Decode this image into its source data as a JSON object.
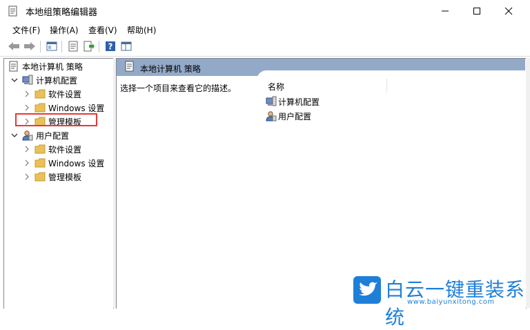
{
  "window": {
    "title": "本地组策略编辑器"
  },
  "menu": [
    "文件(F)",
    "操作(A)",
    "查看(V)",
    "帮助(H)"
  ],
  "tree": {
    "root": "本地计算机 策略",
    "computer_config": "计算机配置",
    "computer_children": [
      "软件设置",
      "Windows 设置",
      "管理模板"
    ],
    "user_config": "用户配置",
    "user_children": [
      "软件设置",
      "Windows 设置",
      "管理模板"
    ]
  },
  "right": {
    "header": "本地计算机 策略",
    "description": "选择一个项目来查看它的描述。",
    "column_name": "名称",
    "items": [
      "计算机配置",
      "用户配置"
    ]
  },
  "watermark": {
    "brand": "白云一键重装系统",
    "url": "www.baiyunxitong.com"
  },
  "colors": {
    "header_band": "#93a9c8",
    "highlight": "#e53935",
    "folder": "#e8c15a",
    "watermark": "#1e7fd8"
  }
}
